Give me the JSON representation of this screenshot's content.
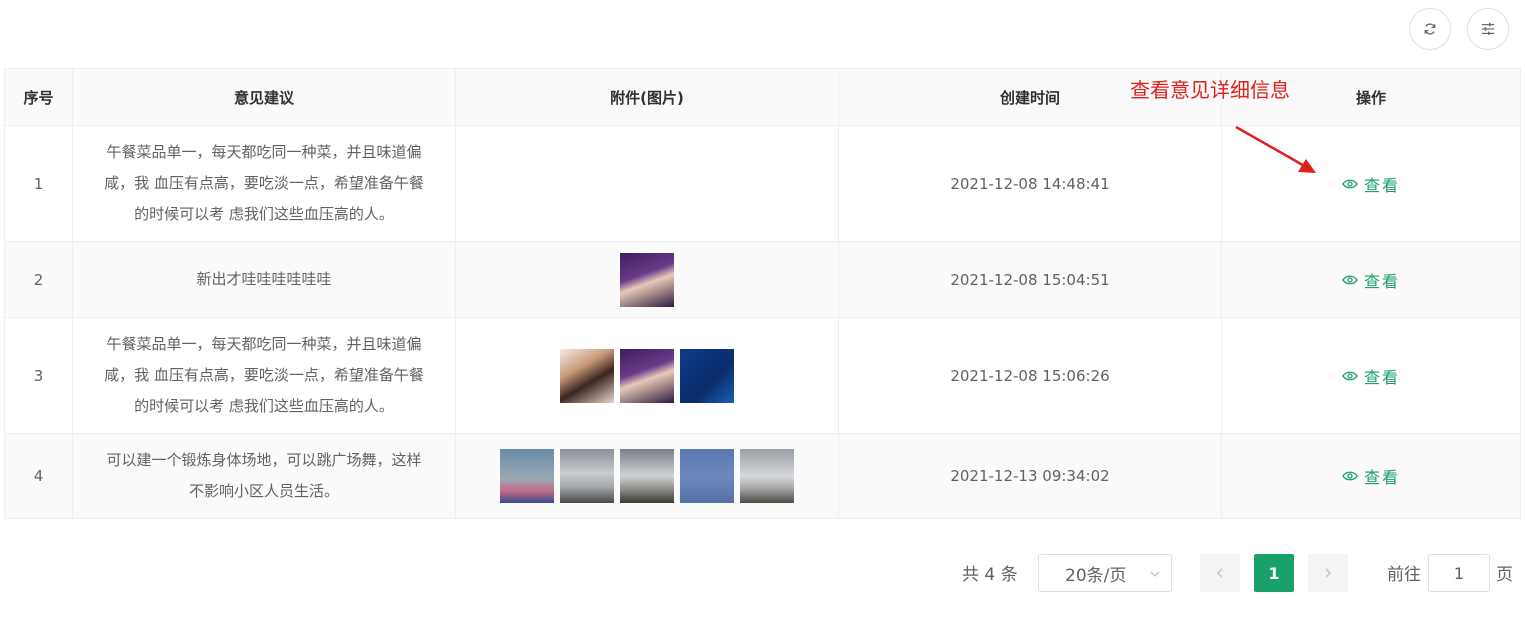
{
  "toolbar": {
    "refresh_icon": "refresh-icon",
    "settings_icon": "sliders-icon"
  },
  "table": {
    "headers": [
      "序号",
      "意见建议",
      "附件(图片)",
      "创建时间",
      "操作"
    ],
    "rows": [
      {
        "index": "1",
        "suggestion_line1": "午餐菜品单一，每天都吃同一种菜，并且味道偏",
        "suggestion_line2": "咸，我 血压有点高，要吃淡一点，希望准备午餐",
        "suggestion_line3": "的时候可以考 虑我们这些血压高的人。",
        "created": "2021-12-08 14:48:41",
        "action": "查看"
      },
      {
        "index": "2",
        "suggestion_line1": "新出才哇哇哇哇哇哇",
        "created": "2021-12-08 15:04:51",
        "action": "查看"
      },
      {
        "index": "3",
        "suggestion_line1": "午餐菜品单一，每天都吃同一种菜，并且味道偏",
        "suggestion_line2": "咸，我 血压有点高，要吃淡一点，希望准备午餐",
        "suggestion_line3": "的时候可以考 虑我们这些血压高的人。",
        "created": "2021-12-08 15:06:26",
        "action": "查看"
      },
      {
        "index": "4",
        "suggestion_line1": "可以建一个锻炼身体场地，可以跳广场舞，这样",
        "suggestion_line2": "不影响小区人员生活。",
        "created": "2021-12-13 09:34:02",
        "action": "查看"
      }
    ]
  },
  "annotation": {
    "text": "查看意见详细信息",
    "color": "#e0201a"
  },
  "pagination": {
    "total": "共 4 条",
    "page_size": "20条/页",
    "current_page": "1",
    "goto_label": "前往",
    "goto_value": "1",
    "page_unit": "页"
  },
  "colors": {
    "accent": "#1aa069",
    "border": "#ebeef5"
  }
}
